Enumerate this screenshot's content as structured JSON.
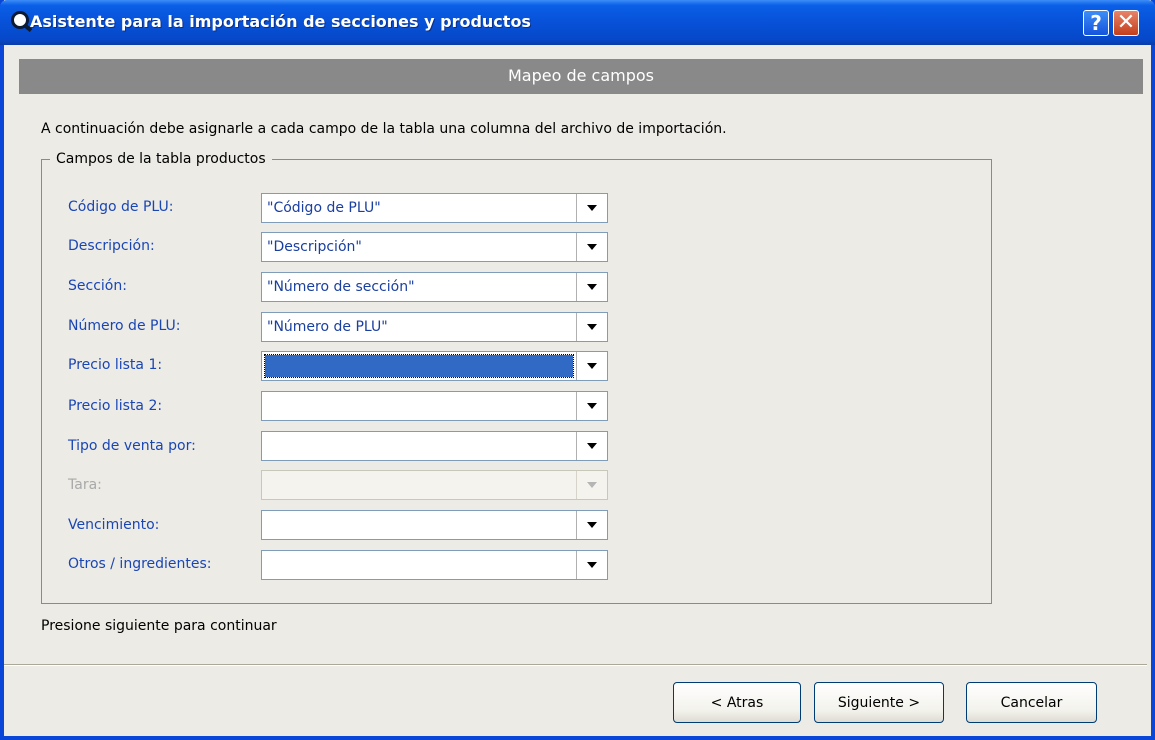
{
  "window": {
    "title": "Asistente para la importación de secciones y productos",
    "help_glyph": "?",
    "close_glyph": "✕"
  },
  "header": {
    "title": "Mapeo de campos"
  },
  "instruction": "A continuación debe asignarle a cada campo de la tabla una columna del archivo de importación.",
  "group": {
    "legend": "Campos de la tabla productos",
    "fields": [
      {
        "label": "Código de PLU:",
        "value": "\"Código de PLU\"",
        "enabled": true
      },
      {
        "label": "Descripción:",
        "value": "\"Descripción\"",
        "enabled": true
      },
      {
        "label": "Sección:",
        "value": "\"Número de sección\"",
        "enabled": true
      },
      {
        "label": "Número de PLU:",
        "value": "\"Número de PLU\"",
        "enabled": true
      },
      {
        "label": "Precio lista 1:",
        "value": "",
        "enabled": true,
        "focused": true
      },
      {
        "label": "Precio lista 2:",
        "value": "",
        "enabled": true
      },
      {
        "label": "Tipo de venta por:",
        "value": "",
        "enabled": true
      },
      {
        "label": "Tara:",
        "value": "",
        "enabled": false
      },
      {
        "label": "Vencimiento:",
        "value": "",
        "enabled": true
      },
      {
        "label": "Otros / ingredientes:",
        "value": "",
        "enabled": true
      }
    ]
  },
  "footer_text": "Presione siguiente para continuar",
  "buttons": {
    "back": "< Atras",
    "next": "Siguiente >",
    "cancel": "Cancelar"
  },
  "colors": {
    "titlebar": "#0751d8",
    "header_band": "#898989",
    "label_blue": "#1a46b4",
    "selection": "#316ac5",
    "window_bg": "#ecebe5"
  }
}
